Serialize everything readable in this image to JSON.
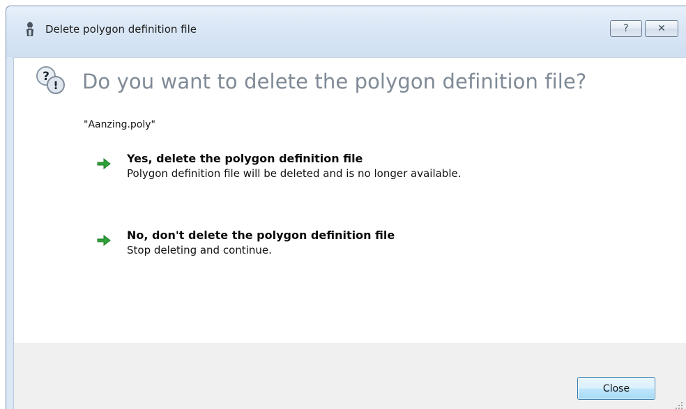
{
  "window": {
    "title": "Delete polygon definition file",
    "help_button": "?",
    "close_button": "✕"
  },
  "dialog": {
    "main_instruction": "Do you want to delete the polygon definition file?",
    "filename": "\"Aanzing.poly\"",
    "options": [
      {
        "title": "Yes, delete the polygon definition file",
        "description": "Polygon definition file will be deleted and is no longer available.",
        "icon": "green-arrow-icon"
      },
      {
        "title": "No, don't delete the polygon definition file",
        "description": "Stop deleting and continue.",
        "icon": "green-arrow-icon"
      }
    ],
    "close_label": "Close"
  },
  "colors": {
    "titlebar": "#d9e6f5",
    "instruction_text": "#7f8a96",
    "arrow_green": "#2fa23a",
    "footer": "#f0f0f0",
    "button_border": "#3c7fb1"
  },
  "icons": {
    "app_icon": "person-app-icon",
    "main_icon": "question-exclamation-bubbles-icon",
    "resize_grip": "resize-grip-icon"
  }
}
